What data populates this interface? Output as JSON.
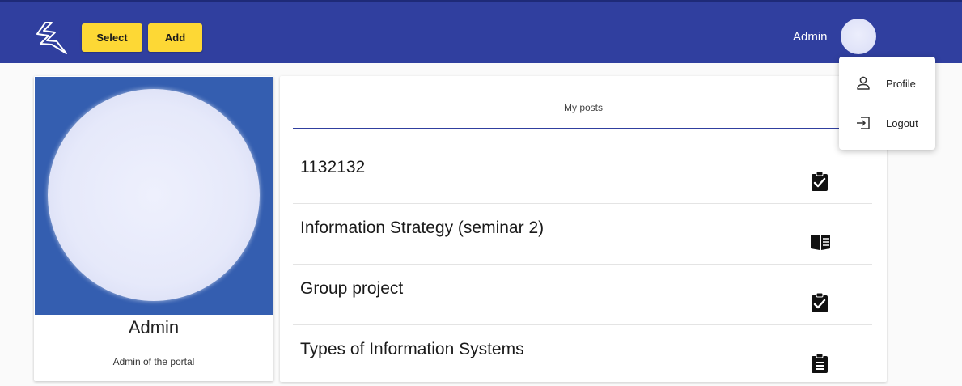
{
  "header": {
    "logo_icon": "lightning-bolt-icon",
    "select_label": "Select",
    "add_label": "Add",
    "user_name": "Admin"
  },
  "user_menu": {
    "items": [
      {
        "label": "Profile",
        "icon": "person-outline-icon"
      },
      {
        "label": "Logout",
        "icon": "logout-icon"
      }
    ]
  },
  "profile": {
    "name": "Admin",
    "role": "Admin of the portal"
  },
  "posts": {
    "tab_label": "My posts",
    "items": [
      {
        "title": "1132132",
        "icon": "clipboard-check-icon"
      },
      {
        "title": "Information Strategy (seminar 2)",
        "icon": "book-open-icon"
      },
      {
        "title": "Group project",
        "icon": "clipboard-check-icon"
      },
      {
        "title": "Types of Information Systems",
        "icon": "clipboard-list-icon"
      }
    ]
  },
  "colors": {
    "topbar": "#303f9f",
    "button": "#fdd835",
    "profile_background": "#345eb0"
  }
}
